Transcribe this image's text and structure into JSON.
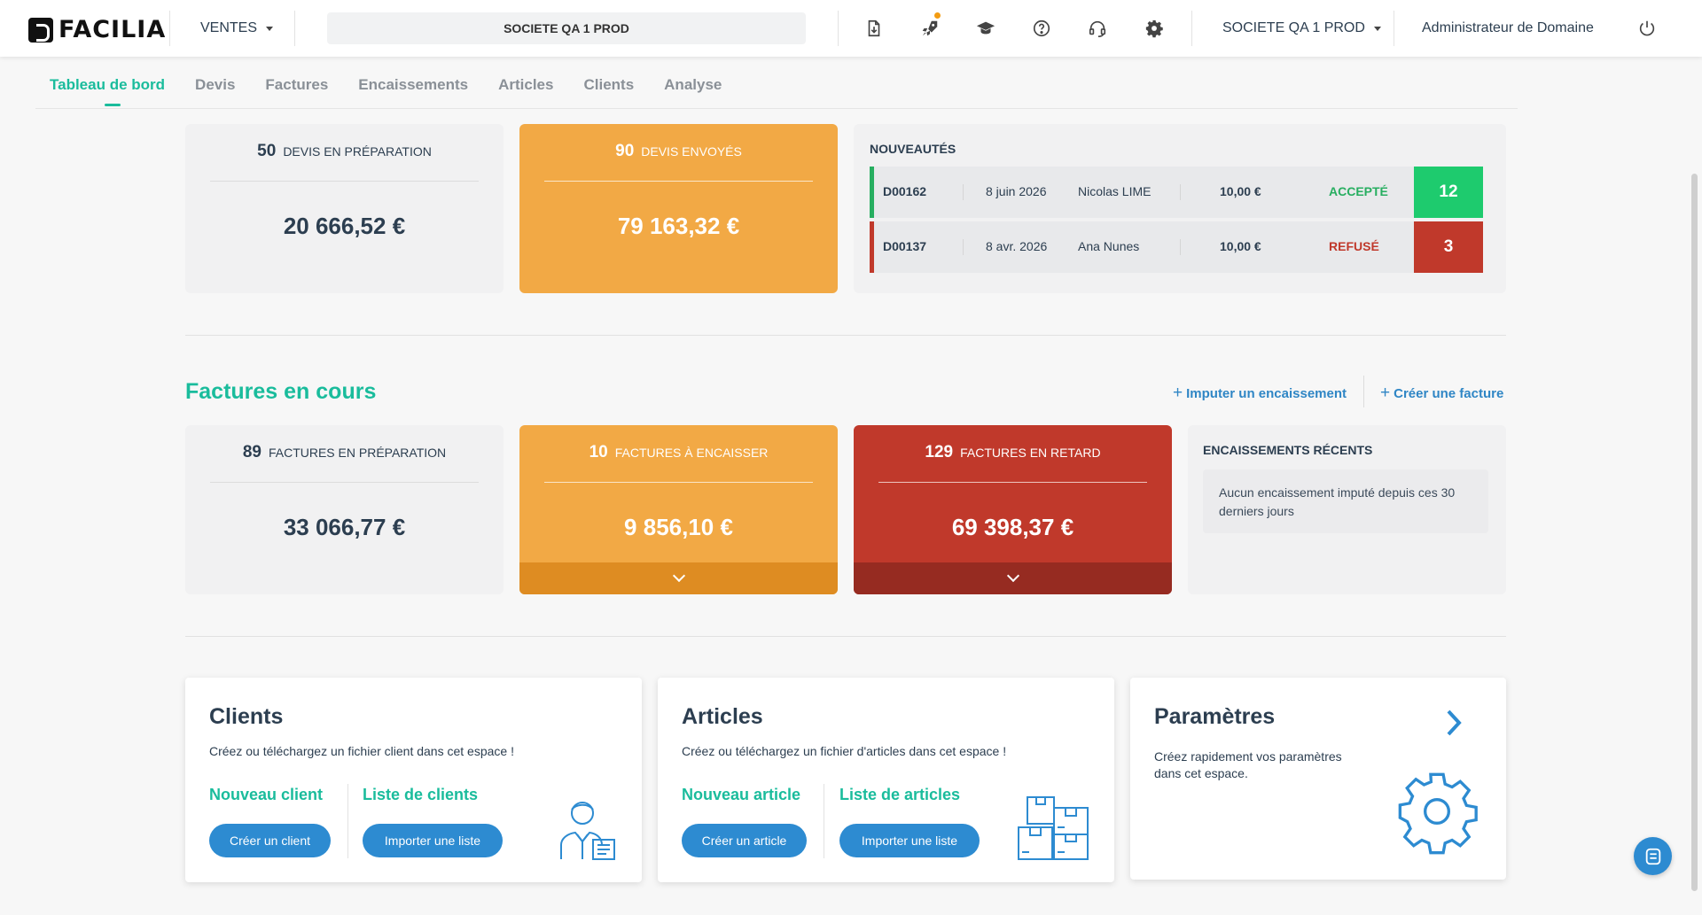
{
  "topbar": {
    "logo_text": "FACILIA",
    "module_label": "VENTES",
    "company_center": "SOCIETE QA 1 PROD",
    "company_selector": "SOCIETE QA 1 PROD",
    "user_label": "Administrateur de Domaine",
    "icons": [
      "document-download-icon",
      "rocket-icon",
      "graduation-cap-icon",
      "help-icon",
      "support-headset-icon",
      "gear-icon",
      "power-icon"
    ]
  },
  "tabs": [
    "Tableau de bord",
    "Devis",
    "Factures",
    "Encaissements",
    "Articles",
    "Clients",
    "Analyse"
  ],
  "devis": {
    "preparation": {
      "count": "50",
      "label": "DEVIS EN PRÉPARATION",
      "amount": "20 666,52 €"
    },
    "envoyes": {
      "count": "90",
      "label": "DEVIS ENVOYÉS",
      "amount": "79 163,32 €"
    },
    "nouveautes": {
      "title": "NOUVEAUTÉS",
      "rows": [
        {
          "ref": "D00162",
          "date": "8 juin 2026",
          "client": "Nicolas LIME",
          "amount": "10,00 €",
          "status": "ACCEPTÉ",
          "badge": "12"
        },
        {
          "ref": "D00137",
          "date": "8 avr. 2026",
          "client": "Ana Nunes",
          "amount": "10,00 €",
          "status": "REFUSÉ",
          "badge": "3"
        }
      ]
    }
  },
  "factures": {
    "title": "Factures en cours",
    "actions": {
      "imputer": "Imputer un encaissement",
      "creer": "Créer une facture"
    },
    "preparation": {
      "count": "89",
      "label": "FACTURES EN PRÉPARATION",
      "amount": "33 066,77 €"
    },
    "a_encaisser": {
      "count": "10",
      "label": "FACTURES À ENCAISSER",
      "amount": "9 856,10 €"
    },
    "en_retard": {
      "count": "129",
      "label": "FACTURES EN RETARD",
      "amount": "69 398,37 €"
    },
    "encaissements": {
      "title": "ENCAISSEMENTS RÉCENTS",
      "empty": "Aucun encaissement imputé depuis ces 30 derniers jours"
    }
  },
  "cards": {
    "clients": {
      "title": "Clients",
      "desc": "Créez ou téléchargez un fichier client dans cet espace !",
      "new_label": "Nouveau client",
      "list_label": "Liste de clients",
      "create_btn": "Créer un client",
      "import_btn": "Importer une liste"
    },
    "articles": {
      "title": "Articles",
      "desc": "Créez ou téléchargez un fichier d'articles dans cet espace !",
      "new_label": "Nouveau article",
      "list_label": "Liste de articles",
      "create_btn": "Créer un article",
      "import_btn": "Importer une liste"
    },
    "parametres": {
      "title": "Paramètres",
      "desc_1": "Créez rapidement vos paramètres",
      "desc_2": "dans cet espace."
    }
  },
  "colors": {
    "accent": "#1abc9c",
    "orange": "#f2a945",
    "red": "#c0392b",
    "blue": "#2d8bd1",
    "accepted": "#27ae60",
    "refused": "#c0392b"
  }
}
